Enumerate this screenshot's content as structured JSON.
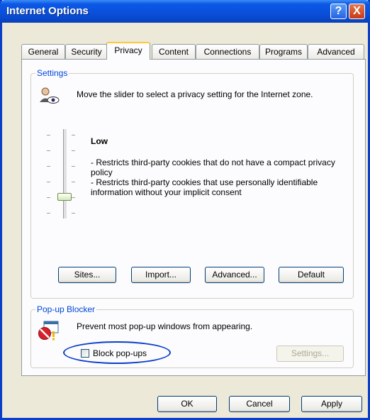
{
  "window": {
    "title": "Internet Options"
  },
  "titlebar_buttons": {
    "help": "?",
    "close": "X"
  },
  "tabs": [
    "General",
    "Security",
    "Privacy",
    "Content",
    "Connections",
    "Programs",
    "Advanced"
  ],
  "active_tab": "Privacy",
  "settings": {
    "group_label": "Settings",
    "intro": "Move the slider to select a privacy setting for the Internet zone.",
    "level_title": "Low",
    "level_desc_1": "- Restricts third-party cookies that do not have a compact privacy policy",
    "level_desc_2": "- Restricts third-party cookies that use personally identifiable information without your implicit consent",
    "slider_level": "Low",
    "buttons": {
      "sites": "Sites...",
      "import": "Import...",
      "advanced": "Advanced...",
      "default": "Default"
    }
  },
  "popup_blocker": {
    "group_label": "Pop-up Blocker",
    "description": "Prevent most pop-up windows from appearing.",
    "checkbox_label": "Block pop-ups",
    "checkbox_checked": false,
    "settings_button": "Settings..."
  },
  "footer": {
    "ok": "OK",
    "cancel": "Cancel",
    "apply": "Apply"
  },
  "colors": {
    "title_bar": "#0b58e6",
    "group_label": "#0046d5",
    "annotation": "#0a3ec8"
  },
  "icons": {
    "privacy": "privacy-person-eye-icon",
    "popup": "popup-blocked-icon"
  }
}
